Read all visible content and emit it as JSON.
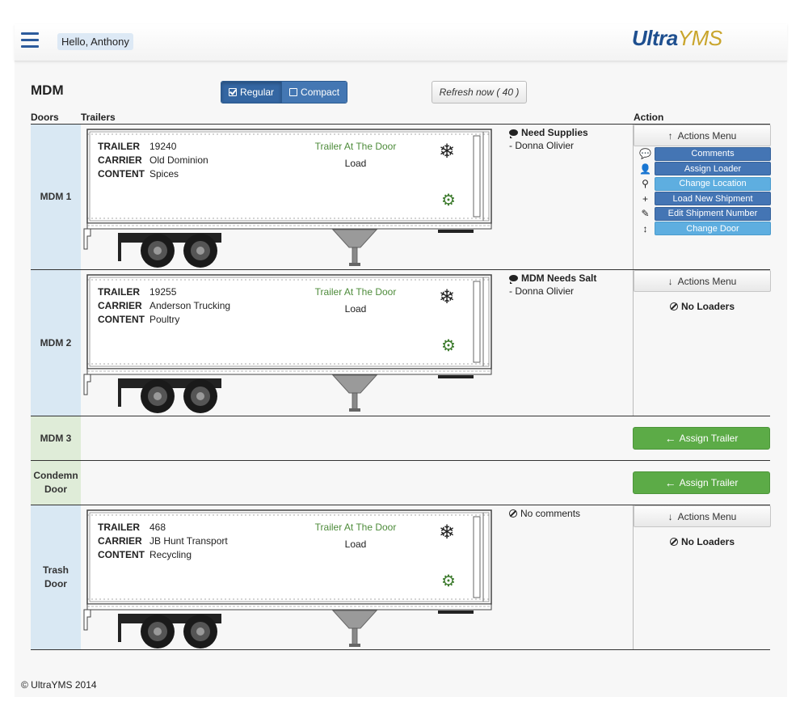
{
  "navbar": {
    "greeting": "Hello, Anthony",
    "logo_primary": "Ultra",
    "logo_secondary": "YMS"
  },
  "page": {
    "title": "MDM",
    "view_toggle": {
      "regular": "Regular",
      "compact": "Compact",
      "selected": "Regular"
    },
    "refresh_label": "Refresh now ( 40 )"
  },
  "headers": {
    "doors": "Doors",
    "trailers": "Trailers",
    "action": "Action"
  },
  "labels": {
    "trailer": "TRAILER",
    "carrier": "CARRIER",
    "content": "CONTENT",
    "actions_menu": "Actions Menu",
    "no_loaders": "No Loaders",
    "no_comments": "No comments",
    "assign_trailer": "Assign Trailer"
  },
  "doors": [
    {
      "name": "MDM 1",
      "trailer": {
        "number": "19240",
        "carrier": "Old Dominion",
        "content": "Spices",
        "status": "Trailer At The Door",
        "type": "Load"
      },
      "comment": {
        "title": "Need Supplies",
        "text": "- Donna Olivier"
      },
      "menu_expanded": true
    },
    {
      "name": "MDM 2",
      "trailer": {
        "number": "19255",
        "carrier": "Anderson Trucking",
        "content": "Poultry",
        "status": "Trailer At The Door",
        "type": "Load"
      },
      "comment": {
        "title": "MDM Needs Salt",
        "text": "- Donna Olivier"
      },
      "menu_expanded": false
    },
    {
      "name": "MDM 3"
    },
    {
      "name_line1": "Condemn",
      "name_line2": "Door"
    },
    {
      "name_line1": "Trash",
      "name_line2": "Door",
      "trailer": {
        "number": "468",
        "carrier": "JB Hunt Transport",
        "content": "Recycling",
        "status": "Trailer At The Door",
        "type": "Load"
      },
      "menu_expanded": false
    }
  ],
  "actions_menu_items": [
    {
      "label": "Comments",
      "icon": "comment-icon",
      "glyph": "💬",
      "style": "dark"
    },
    {
      "label": "Assign Loader",
      "icon": "user-icon",
      "glyph": "👤",
      "style": "dark"
    },
    {
      "label": "Change Location",
      "icon": "map-marker-icon",
      "glyph": "⚲",
      "style": "light"
    },
    {
      "label": "Load New Shipment",
      "icon": "plus-icon",
      "glyph": "+",
      "style": "dark"
    },
    {
      "label": "Edit Shipment Number",
      "icon": "pencil-icon",
      "glyph": "✎",
      "style": "dark"
    },
    {
      "label": "Change Door",
      "icon": "vertical-resize-icon",
      "glyph": "↕",
      "style": "light"
    }
  ],
  "footer": "© UltraYMS 2014",
  "colors": {
    "primary_blue": "#3466a2",
    "light_blue": "#5eaee0",
    "success_green": "#5cab47",
    "status_green": "#4d8b3a",
    "door_blue_bg": "#d9e8f3",
    "door_green_bg": "#dfecd8",
    "logo_blue": "#1e4f8f",
    "logo_gold": "#c9a52c"
  }
}
